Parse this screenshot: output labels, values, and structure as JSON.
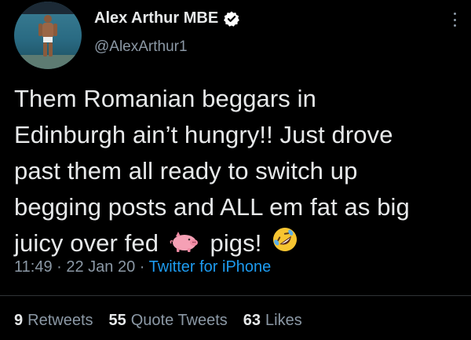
{
  "author": {
    "display_name": "Alex Arthur MBE",
    "handle": "@AlexArthur1",
    "verified": true
  },
  "tweet": {
    "lines": [
      "Them Romanian beggars in",
      "Edinburgh ain’t hungry!! Just drove",
      "past them all ready to switch up",
      "begging posts and ALL em fat as big"
    ],
    "last_line_part1": "juicy over fed",
    "last_line_part2": "pigs!",
    "emojis": [
      "pig-emoji",
      "rolling-on-floor-laughing-emoji"
    ]
  },
  "meta": {
    "time": "11:49",
    "sep1": "·",
    "date": "22 Jan 20",
    "sep2": "·",
    "source": "Twitter for iPhone"
  },
  "stats": {
    "retweets_count": "9",
    "retweets_label": "Retweets",
    "quotes_count": "55",
    "quotes_label": "Quote Tweets",
    "likes_count": "63",
    "likes_label": "Likes"
  },
  "colors": {
    "background": "#000000",
    "text": "#e7e9ea",
    "secondary": "#8b98a5",
    "link": "#1d9bf0",
    "verified": "#ffffff"
  }
}
